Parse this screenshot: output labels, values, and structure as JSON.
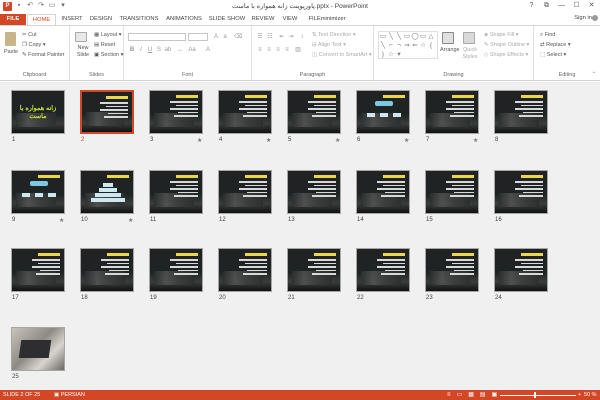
{
  "window": {
    "title": "پاورپوینت زانه همواره با ماست.pptx - PowerPoint",
    "controls": [
      "?",
      "⧉",
      "—",
      "☐",
      "✕"
    ]
  },
  "tabs": [
    {
      "label": "FILE"
    },
    {
      "label": "HOME"
    },
    {
      "label": "INSERT"
    },
    {
      "label": "DESIGN"
    },
    {
      "label": "TRANSITIONS"
    },
    {
      "label": "ANIMATIONS"
    },
    {
      "label": "SLIDE SHOW"
    },
    {
      "label": "REVIEW"
    },
    {
      "label": "VIEW"
    },
    {
      "label": "FILEminimizer"
    }
  ],
  "sign_in": "Sign in",
  "ribbon": {
    "clipboard": {
      "label": "Clipboard",
      "paste": "Paste",
      "cut": "Cut",
      "copy": "Copy",
      "format_painter": "Format Painter"
    },
    "slides": {
      "label": "Slides",
      "new_slide": "New Slide",
      "layout": "Layout",
      "reset": "Reset",
      "section": "Section"
    },
    "font": {
      "label": "Font"
    },
    "paragraph": {
      "label": "Paragraph",
      "text_direction": "Text Direction",
      "align_text": "Align Text",
      "convert_smartart": "Convert to SmartArt"
    },
    "drawing": {
      "label": "Drawing",
      "arrange": "Arrange",
      "quick_styles": "Quick Styles",
      "shape_fill": "Shape Fill",
      "shape_outline": "Shape Outline",
      "shape_effects": "Shape Effects"
    },
    "editing": {
      "label": "Editing",
      "find": "Find",
      "replace": "Replace",
      "select": "Select"
    }
  },
  "slides": [
    {
      "num": "1",
      "type": "title",
      "star": false
    },
    {
      "num": "2",
      "type": "text",
      "star": false,
      "selected": true
    },
    {
      "num": "3",
      "type": "text",
      "star": true
    },
    {
      "num": "4",
      "type": "text",
      "star": true
    },
    {
      "num": "5",
      "type": "text",
      "star": true
    },
    {
      "num": "6",
      "type": "diagram",
      "star": true
    },
    {
      "num": "7",
      "type": "text",
      "star": true
    },
    {
      "num": "8",
      "type": "text",
      "star": false
    },
    {
      "num": "9",
      "type": "diagram",
      "star": true
    },
    {
      "num": "10",
      "type": "pyramid",
      "star": true
    },
    {
      "num": "11",
      "type": "text",
      "star": false
    },
    {
      "num": "12",
      "type": "text",
      "star": false
    },
    {
      "num": "13",
      "type": "text",
      "star": false
    },
    {
      "num": "14",
      "type": "text",
      "star": false
    },
    {
      "num": "15",
      "type": "text",
      "star": false
    },
    {
      "num": "16",
      "type": "text",
      "star": false
    },
    {
      "num": "17",
      "type": "text",
      "star": false
    },
    {
      "num": "18",
      "type": "text",
      "star": false
    },
    {
      "num": "19",
      "type": "text",
      "star": false
    },
    {
      "num": "20",
      "type": "text",
      "star": false
    },
    {
      "num": "21",
      "type": "text",
      "star": false
    },
    {
      "num": "22",
      "type": "text",
      "star": false
    },
    {
      "num": "23",
      "type": "text",
      "star": false
    },
    {
      "num": "24",
      "type": "text",
      "star": false
    },
    {
      "num": "25",
      "type": "photo",
      "star": false
    }
  ],
  "title_slide_text": "زانه همواره با ماست",
  "status": {
    "slide_info": "SLIDE 2 OF 25",
    "language": "PERSIAN",
    "zoom": "50 %",
    "zoom_level_percent": 50,
    "minus": "−",
    "plus": "+"
  },
  "colors": {
    "accent": "#d24726",
    "selected_border": "#d24726",
    "slide_title": "#e8d84a",
    "title_slide_text": "#c8e03a"
  }
}
